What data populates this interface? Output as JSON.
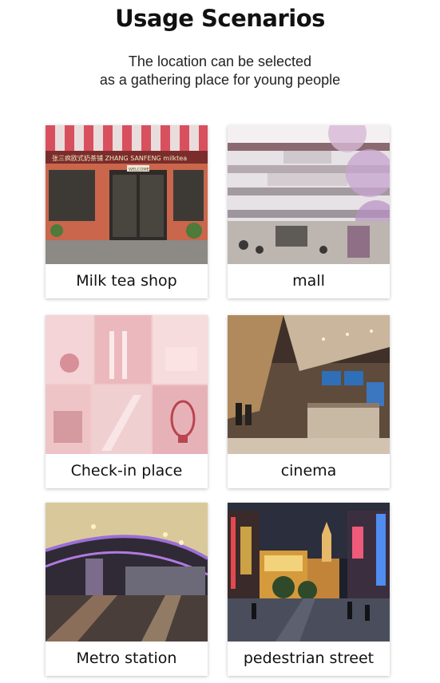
{
  "header": {
    "title": "Usage Scenarios",
    "subtitle_line1": "The location can be selected",
    "subtitle_line2": "as a gathering place for young people"
  },
  "scenarios": [
    {
      "label": "Milk tea shop",
      "image": "milk-tea-shop-photo"
    },
    {
      "label": "mall",
      "image": "mall-photo"
    },
    {
      "label": "Check-in place",
      "image": "check-in-place-photo"
    },
    {
      "label": "cinema",
      "image": "cinema-photo"
    },
    {
      "label": "Metro station",
      "image": "metro-station-photo"
    },
    {
      "label": "pedestrian street",
      "image": "pedestrian-street-photo"
    }
  ],
  "photo_text": {
    "milk_tea_sign": "张三疯欧式奶茶铺  ZHANG SANFENG milktea",
    "milk_tea_door_sign": "WELCOME"
  }
}
